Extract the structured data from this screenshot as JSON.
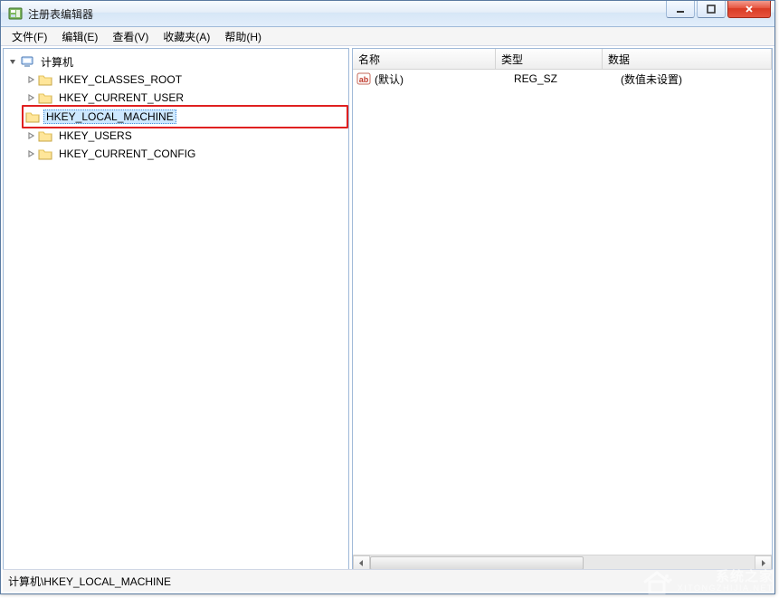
{
  "window": {
    "title": "注册表编辑器"
  },
  "menu": {
    "file": "文件(F)",
    "edit": "编辑(E)",
    "view": "查看(V)",
    "favorites": "收藏夹(A)",
    "help": "帮助(H)"
  },
  "tree": {
    "root_label": "计算机",
    "keys": [
      "HKEY_CLASSES_ROOT",
      "HKEY_CURRENT_USER",
      "HKEY_LOCAL_MACHINE",
      "HKEY_USERS",
      "HKEY_CURRENT_CONFIG"
    ],
    "highlighted_index": 2
  },
  "list": {
    "columns": {
      "name": "名称",
      "type": "类型",
      "data": "数据"
    },
    "rows": [
      {
        "name": "(默认)",
        "type": "REG_SZ",
        "data": "(数值未设置)"
      }
    ]
  },
  "statusbar": {
    "path": "计算机\\HKEY_LOCAL_MACHINE"
  },
  "watermark": {
    "line1": "系统之家",
    "line2": "XITONGZHIJIA.NET"
  }
}
